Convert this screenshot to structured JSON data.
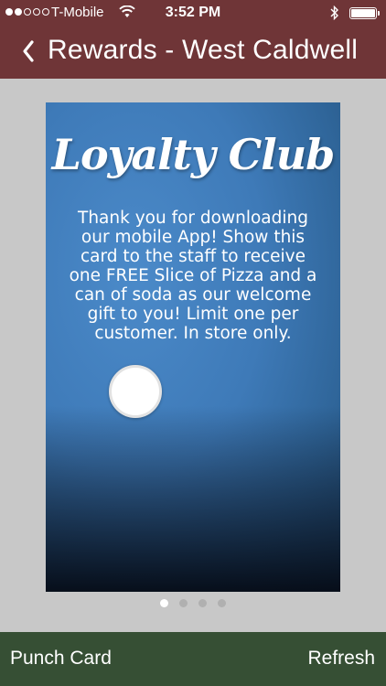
{
  "status_bar": {
    "carrier": "T-Mobile",
    "time": "3:52 PM",
    "signal_bars_filled": 2,
    "signal_bars_total": 5
  },
  "nav": {
    "back_icon": "chevron-left-icon",
    "title": "Rewards - West Caldwell"
  },
  "card": {
    "title": "Loyalty Club",
    "message": "Thank you for downloading our mobile App! Show this card to the staff to receive one FREE Slice of Pizza and a can of soda as our welcome gift to you! Limit one per customer. In store only.",
    "punches_total": 1,
    "punches_filled": 0
  },
  "pager": {
    "page_count": 4,
    "current_page": 1
  },
  "bottom_bar": {
    "left_label": "Punch Card",
    "right_label": "Refresh"
  },
  "colors": {
    "header_bg": "#6f3537",
    "bottom_bar_bg": "#364f34",
    "card_blue": "#3e7ab8",
    "page_bg": "#c8c8c8"
  }
}
